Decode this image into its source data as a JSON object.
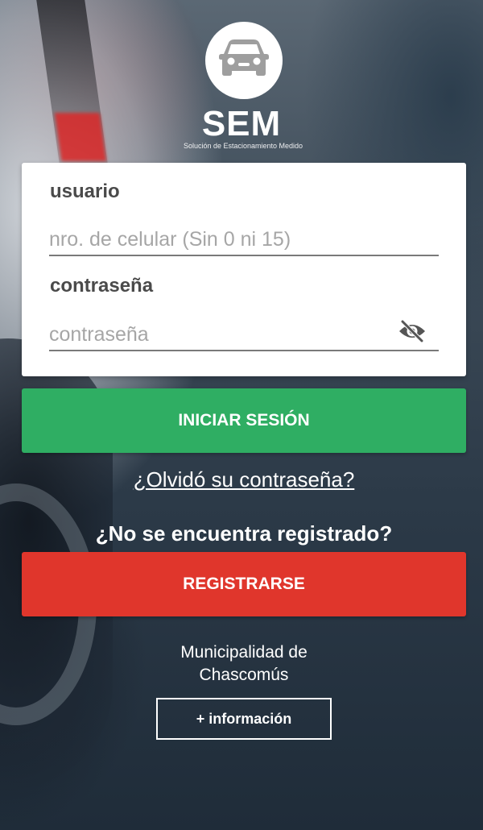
{
  "logo": {
    "icon": "car-icon",
    "title": "SEM",
    "subtitle": "Solución de Estacionamiento Medido"
  },
  "login": {
    "user_label": "usuario",
    "user_value": "",
    "user_placeholder": "nro. de celular (Sin 0 ni 15)",
    "password_label": "contraseña",
    "password_value": "",
    "password_placeholder": "contraseña",
    "password_toggle_icon": "eye-off-icon",
    "submit_label": "INICIAR SESIÓN",
    "forgot_link": "¿Olvidó su contraseña?"
  },
  "register": {
    "prompt": "¿No se encuentra registrado?",
    "button_label": "REGISTRARSE"
  },
  "footer": {
    "municipality_line1": "Municipalidad de",
    "municipality_line2": "Chascomús",
    "info_button": "+ información"
  },
  "colors": {
    "login_button": "#2fae63",
    "register_button": "#e0362c",
    "card_background": "#ffffff"
  }
}
